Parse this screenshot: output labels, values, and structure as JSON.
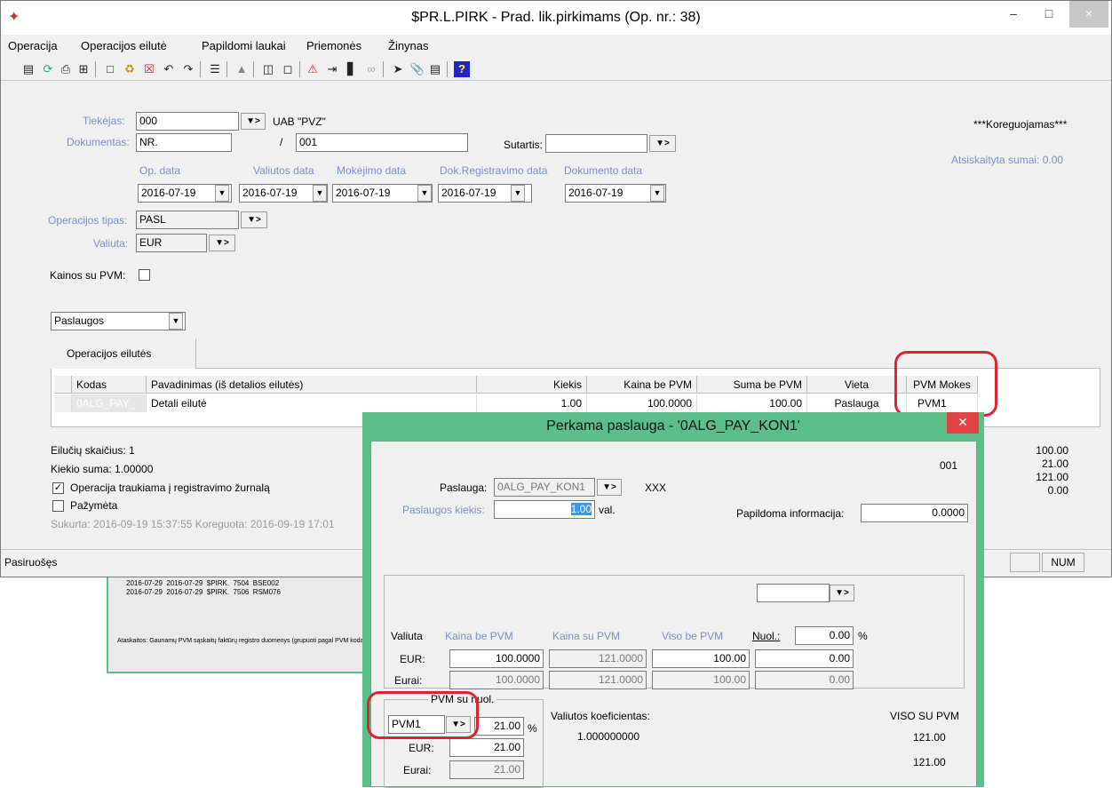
{
  "window": {
    "title": "$PR.L.PIRK - Prad. lik.pirkimams (Op. nr.: 38)",
    "min": "–",
    "max": "□",
    "close": "×"
  },
  "menu": [
    "Operacija",
    "Operacijos eilutė",
    "Papildomi laukai",
    "Priemonės",
    "Žinynas"
  ],
  "status_top_right": "***Koreguojamas***",
  "atsiskaityta": "Atsiskaityta sumai: 0.00",
  "form": {
    "tiekejas_label": "Tiekėjas:",
    "tiekejas_value": "000",
    "tiekejas_name": "UAB \"PVZ\"",
    "dokumentas_label": "Dokumentas:",
    "dokumentas_value": "NR.",
    "slash": "/",
    "dokumentas_nr": "001",
    "sutartis_label": "Sutartis:",
    "sutartis_value": "",
    "op_data_label": "Op. data",
    "valiutos_data_label": "Valiutos data",
    "mokejimo_data_label": "Mokėjimo data",
    "dok_reg_label": "Dok.Registravimo data",
    "dokumento_data_label": "Dokumento data",
    "op_data": "2016-07-19",
    "valiutos_data": "2016-07-19",
    "mokejimo_data": "2016-07-19",
    "dok_reg_data": "2016-07-19",
    "dokumento_data": "2016-07-19",
    "op_tipas_label": "Operacijos tipas:",
    "op_tipas_value": "PASL",
    "valiuta_label": "Valiuta:",
    "valiuta_value": "EUR",
    "kainos_pvm_label": "Kainos su PVM:",
    "category_select": "Paslaugos"
  },
  "tab": "Operacijos eilutės",
  "grid": {
    "headers": [
      "Kodas",
      "Pavadinimas (iš detalios eilutės)",
      "Kiekis",
      "Kaina be PVM",
      "Suma be PVM",
      "Vieta",
      "PVM Mokes"
    ],
    "row": [
      "0ALG_PAY_",
      "Detali eilutė",
      "1.00",
      "100.0000",
      "100.00",
      "Paslauga",
      "PVM1"
    ]
  },
  "summary": {
    "eiluciu": "Eilučių skaičius: 1",
    "kiekio": "Kiekio suma: 1.00000",
    "traukiama": "Operacija traukiama į registravimo žurnalą",
    "pazymeta": "Pažymėta",
    "sukurta": "Sukurta: 2016-09-19 15:37:55 Koreguota: 2016-09-19 17:01",
    "totals": [
      "100.00",
      "21.00",
      "121.00",
      "0.00"
    ]
  },
  "statusbar": {
    "text": "Pasiruošęs",
    "num": "NUM"
  },
  "dialog": {
    "title": "Perkama paslauga - '0ALG_PAY_KON1'",
    "nr": "001",
    "paslauga_label": "Paslauga:",
    "paslauga_value": "0ALG_PAY_KON1",
    "paslauga_name": "XXX",
    "kiekis_label": "Paslaugos kiekis:",
    "kiekis_value": "1.00",
    "kiekis_unit": "val.",
    "papildoma_label": "Papildoma informacija:",
    "papildoma_value": "0.0000",
    "top_select": "",
    "valiuta_col": "Valiuta",
    "kaina_be_col": "Kaina be PVM",
    "kaina_su_col": "Kaina su PVM",
    "viso_be_col": "Viso be PVM",
    "nuol_label": "Nuol.:",
    "nuol_value": "0.00",
    "percent": "%",
    "eur_label": "EUR:",
    "eurai_label": "Eurai:",
    "eur_row": [
      "100.0000",
      "121.0000",
      "100.00",
      "0.00"
    ],
    "eurai_row": [
      "100.0000",
      "121.0000",
      "100.00",
      "0.00"
    ],
    "pvm_group": "PVM su nuol.",
    "pvm_code": "PVM1",
    "pvm_rate": "21.00",
    "pvm_eur": "21.00",
    "pvm_eurai": "21.00",
    "koef_label": "Valiutos koeficientas:",
    "koef_value": "1.000000000",
    "viso_su_label": "VISO SU PVM",
    "viso_su_1": "121.00",
    "viso_su_2": "121.00"
  },
  "background": {
    "rows": [
      [
        "2016-07-29",
        "2016-07-29",
        "$PIRK.",
        "7504",
        "BSE002"
      ],
      [
        "2016-07-29",
        "2016-07-29",
        "$PIRK.",
        "7506",
        "RSM076"
      ]
    ],
    "ataskaitos_label": "Ataskaitos:",
    "ataskaitos_value": "Gaunamų PVM sąskaitų faktūrų registro duomenys (grupuoti pagal PVM kodą)"
  }
}
